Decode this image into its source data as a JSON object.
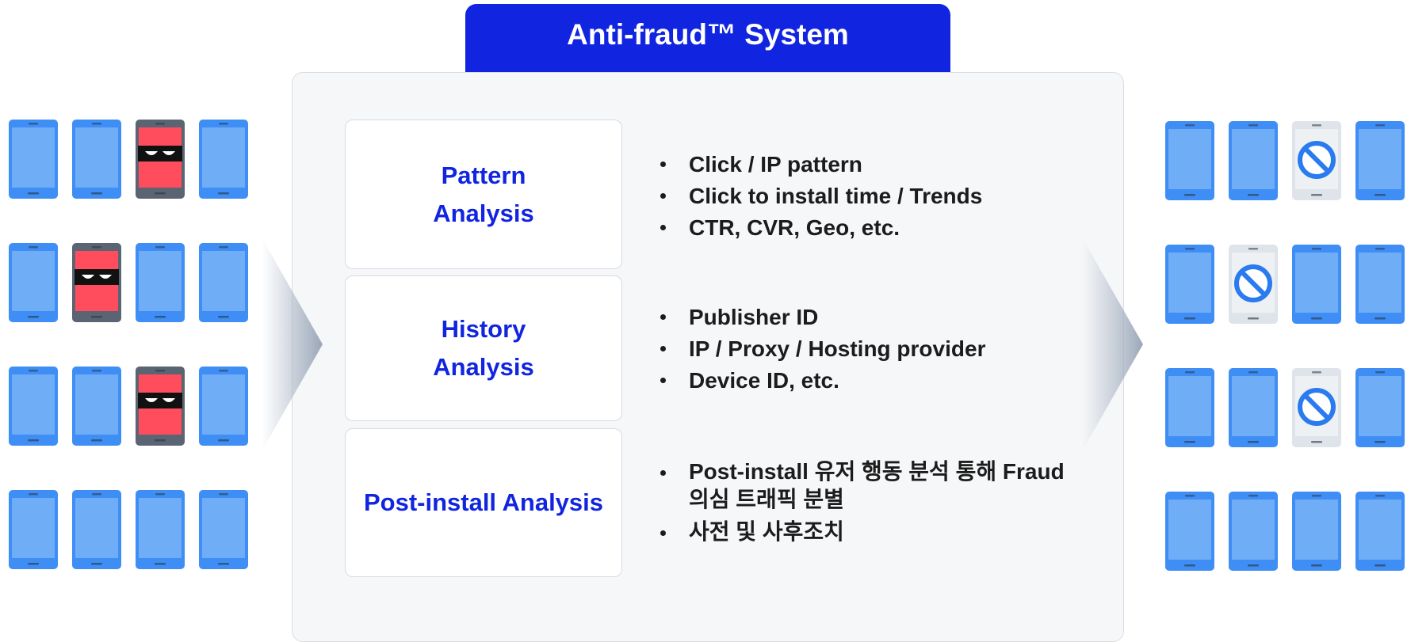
{
  "title": "Anti-fraud™ System",
  "colors": {
    "title_bg": "#1124e0",
    "accent_text": "#1124e0",
    "phone_body": "#3f8ef5",
    "phone_screen": "#6fadf7",
    "fraud_body": "#5a6472",
    "fraud_screen": "#ff4d5e",
    "blocked_body": "#dfe4ea",
    "blocked_screen": "#eef1f4",
    "block_icon": "#2a7af0"
  },
  "analyses": [
    {
      "title_lines": [
        "Pattern",
        "Analysis"
      ],
      "bullets": [
        "Click / IP pattern",
        "Click to install time / Trends",
        "CTR, CVR, Geo, etc."
      ]
    },
    {
      "title_lines": [
        "History",
        "Analysis"
      ],
      "bullets": [
        "Publisher ID",
        "IP / Proxy / Hosting provider",
        "Device ID, etc."
      ]
    },
    {
      "title_lines": [
        "Post-install Analysis"
      ],
      "bullets": [
        "Post-install 유저 행동 분석 통해 Fraud 의심 트래픽 분별",
        "사전 및 사후조치"
      ]
    }
  ],
  "input_traffic": {
    "icons": [
      "phone-icon",
      "fraud-phone-icon"
    ],
    "rows": [
      [
        "normal",
        "normal",
        "fraud",
        "normal"
      ],
      [
        "normal",
        "fraud",
        "normal",
        "normal"
      ],
      [
        "normal",
        "normal",
        "fraud",
        "normal"
      ],
      [
        "normal",
        "normal",
        "normal",
        "normal"
      ]
    ]
  },
  "output_traffic": {
    "icons": [
      "phone-icon",
      "blocked-phone-icon"
    ],
    "rows": [
      [
        "normal",
        "normal",
        "blocked",
        "normal"
      ],
      [
        "normal",
        "blocked",
        "normal",
        "normal"
      ],
      [
        "normal",
        "normal",
        "blocked",
        "normal"
      ],
      [
        "normal",
        "normal",
        "normal",
        "normal"
      ]
    ]
  }
}
